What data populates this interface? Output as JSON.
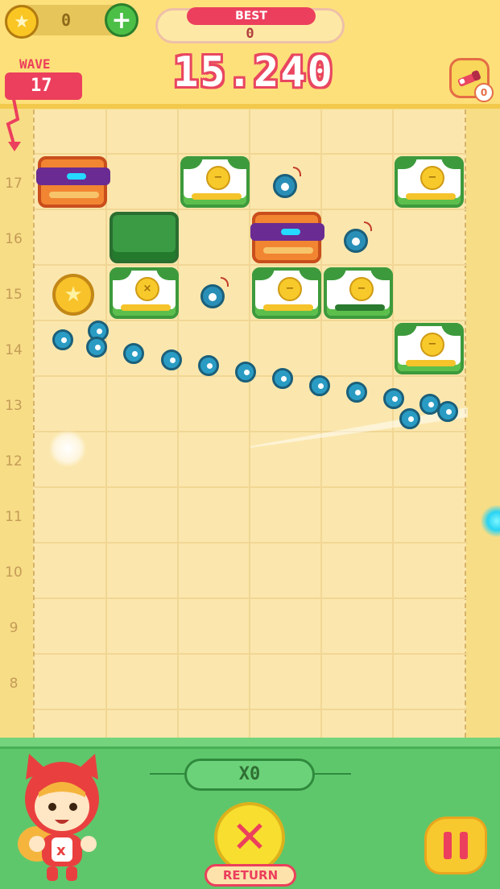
{
  "header": {
    "coins": "0",
    "add_coin_icon": "plus-icon",
    "best_label": "BEST",
    "best_value": "0",
    "score": "15.240",
    "wave_label": "WAVE",
    "wave_number": "17",
    "telescope_count": "0"
  },
  "board": {
    "row_labels": [
      "17",
      "16",
      "15",
      "14",
      "13",
      "12",
      "11",
      "10",
      "9",
      "8"
    ],
    "coin_block_symbols": {
      "block_1_3": "−",
      "block_15_2": "×",
      "block_15_4": "−",
      "block_15_5": "−",
      "block_17_6": "−",
      "block_14_6": "−"
    }
  },
  "footer": {
    "combo": "X0",
    "return_label": "RETURN"
  },
  "colors": {
    "header_bg": "#fde07a",
    "board_bg": "#fbe7ad",
    "footer_bg": "#5fc76b",
    "accent_red": "#ec3f5d",
    "ball_blue": "#2a9cc4"
  }
}
